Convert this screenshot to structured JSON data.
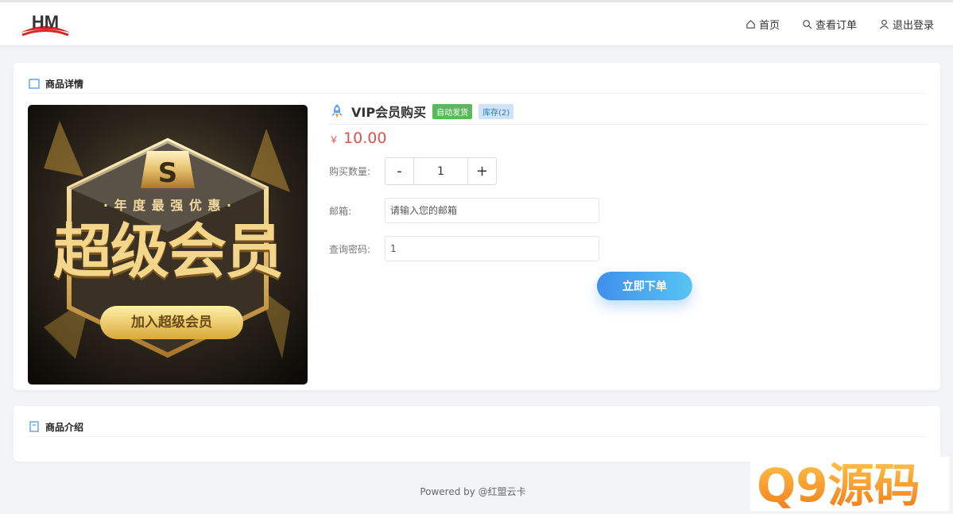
{
  "nav": {
    "home": "首页",
    "orders": "查看订单",
    "logout": "退出登录"
  },
  "details": {
    "section_title": "商品详情",
    "image": {
      "line1": "· 年 度 最 强 优 惠 ·",
      "line2": "超级会员",
      "button": "加入超级会员"
    },
    "product_name": "VIP会员购买",
    "badge_auto": "自动发货",
    "badge_stock": "库存(2)",
    "currency": "￥",
    "price": "10.00",
    "qty_label": "购买数量:",
    "qty_minus": "-",
    "qty_value": "1",
    "qty_plus": "+",
    "email_label": "邮箱:",
    "email_placeholder": "请输入您的邮箱",
    "password_label": "查询密码:",
    "password_value": "1",
    "order_button": "立即下单"
  },
  "intro": {
    "section_title": "商品介绍"
  },
  "footer": "Powered by @红盟云卡",
  "watermark": "Q9源码",
  "colors": {
    "accent": "#3f8fea",
    "price": "#d9534f",
    "badge_auto": "#5cb85c",
    "badge_stock_bg": "#cfe3f7",
    "watermark": "#f39c12"
  }
}
